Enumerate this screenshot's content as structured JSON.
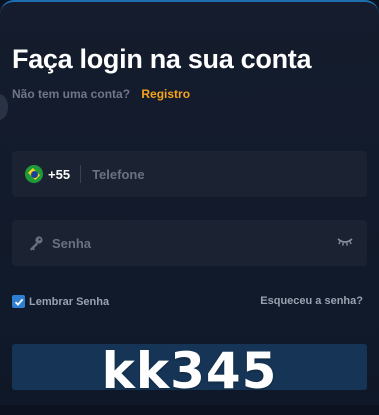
{
  "header": {
    "title": "Faça login na sua conta",
    "no_account_text": "Não tem uma conta?",
    "register_link": "Registro"
  },
  "phone_field": {
    "country_code": "+55",
    "flag_icon": "brazil-flag-icon",
    "placeholder": "Telefone",
    "value": ""
  },
  "password_field": {
    "icon": "key-icon",
    "placeholder": "Senha",
    "value": "",
    "toggle_icon": "eye-closed-icon"
  },
  "options": {
    "remember_label": "Lembrar Senha",
    "remember_checked": true,
    "forgot_link": "Esqueceu a senha?"
  },
  "watermark": "kk345",
  "colors": {
    "background": "#141c2d",
    "field": "#1b2232",
    "accent": "#f5a31a",
    "checkbox": "#2f7fd1",
    "button": "#163556"
  }
}
